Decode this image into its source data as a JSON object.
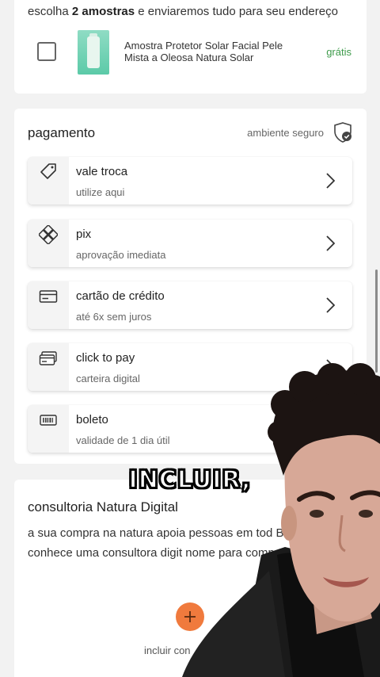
{
  "samples": {
    "intro_prefix": "escolha",
    "intro_bold": "2 amostras",
    "intro_suffix": "e enviaremos tudo para seu endereço",
    "product_name": "Amostra Protetor Solar Facial Pele Mista a Oleosa Natura Solar",
    "price_label": "grátis"
  },
  "payment": {
    "title": "pagamento",
    "secure_label": "ambiente seguro",
    "options": [
      {
        "label": "vale troca",
        "sub": "utilize aqui",
        "icon": "tag-icon"
      },
      {
        "label": "pix",
        "sub": "aprovação imediata",
        "icon": "pix-icon"
      },
      {
        "label": "cartão de crédito",
        "sub": "até 6x sem juros",
        "icon": "credit-card-icon"
      },
      {
        "label": "click to pay",
        "sub": "carteira digital",
        "icon": "click-to-pay-icon"
      },
      {
        "label": "boleto",
        "sub": "validade de 1 dia útil",
        "icon": "barcode-icon"
      }
    ]
  },
  "consult": {
    "title": "consultoria Natura Digital",
    "text": "a sua compra na natura apoia pessoas em tod Brasil, se você conhece uma consultora digit nome para comprar com ela:",
    "add_label": "incluir con"
  },
  "overlay": {
    "caption": "INCLUIR,"
  },
  "colors": {
    "accent_orange": "#f07a3d",
    "free_green": "#3e9b4b"
  }
}
